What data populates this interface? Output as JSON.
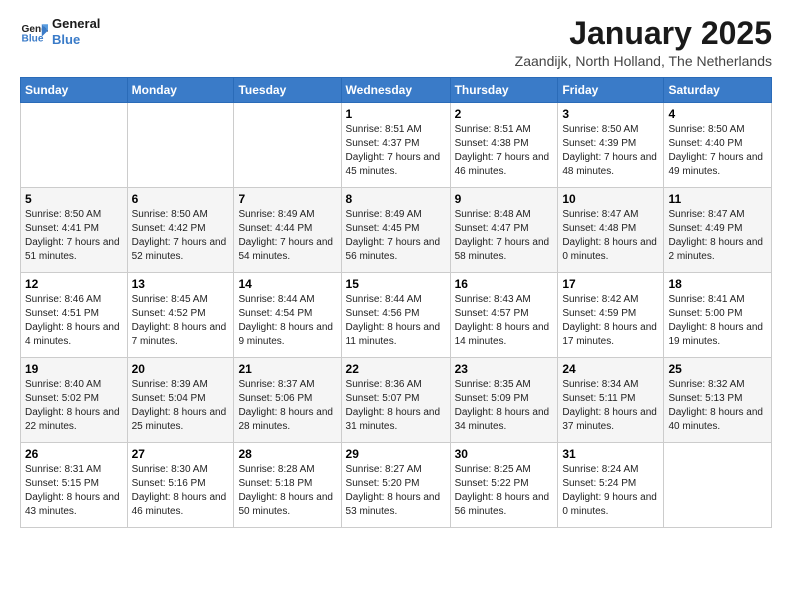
{
  "logo": {
    "text_general": "General",
    "text_blue": "Blue"
  },
  "header": {
    "title": "January 2025",
    "subtitle": "Zaandijk, North Holland, The Netherlands"
  },
  "weekdays": [
    "Sunday",
    "Monday",
    "Tuesday",
    "Wednesday",
    "Thursday",
    "Friday",
    "Saturday"
  ],
  "weeks": [
    [
      {
        "day": "",
        "sunrise": "",
        "sunset": "",
        "daylight": ""
      },
      {
        "day": "",
        "sunrise": "",
        "sunset": "",
        "daylight": ""
      },
      {
        "day": "",
        "sunrise": "",
        "sunset": "",
        "daylight": ""
      },
      {
        "day": "1",
        "sunrise": "Sunrise: 8:51 AM",
        "sunset": "Sunset: 4:37 PM",
        "daylight": "Daylight: 7 hours and 45 minutes."
      },
      {
        "day": "2",
        "sunrise": "Sunrise: 8:51 AM",
        "sunset": "Sunset: 4:38 PM",
        "daylight": "Daylight: 7 hours and 46 minutes."
      },
      {
        "day": "3",
        "sunrise": "Sunrise: 8:50 AM",
        "sunset": "Sunset: 4:39 PM",
        "daylight": "Daylight: 7 hours and 48 minutes."
      },
      {
        "day": "4",
        "sunrise": "Sunrise: 8:50 AM",
        "sunset": "Sunset: 4:40 PM",
        "daylight": "Daylight: 7 hours and 49 minutes."
      }
    ],
    [
      {
        "day": "5",
        "sunrise": "Sunrise: 8:50 AM",
        "sunset": "Sunset: 4:41 PM",
        "daylight": "Daylight: 7 hours and 51 minutes."
      },
      {
        "day": "6",
        "sunrise": "Sunrise: 8:50 AM",
        "sunset": "Sunset: 4:42 PM",
        "daylight": "Daylight: 7 hours and 52 minutes."
      },
      {
        "day": "7",
        "sunrise": "Sunrise: 8:49 AM",
        "sunset": "Sunset: 4:44 PM",
        "daylight": "Daylight: 7 hours and 54 minutes."
      },
      {
        "day": "8",
        "sunrise": "Sunrise: 8:49 AM",
        "sunset": "Sunset: 4:45 PM",
        "daylight": "Daylight: 7 hours and 56 minutes."
      },
      {
        "day": "9",
        "sunrise": "Sunrise: 8:48 AM",
        "sunset": "Sunset: 4:47 PM",
        "daylight": "Daylight: 7 hours and 58 minutes."
      },
      {
        "day": "10",
        "sunrise": "Sunrise: 8:47 AM",
        "sunset": "Sunset: 4:48 PM",
        "daylight": "Daylight: 8 hours and 0 minutes."
      },
      {
        "day": "11",
        "sunrise": "Sunrise: 8:47 AM",
        "sunset": "Sunset: 4:49 PM",
        "daylight": "Daylight: 8 hours and 2 minutes."
      }
    ],
    [
      {
        "day": "12",
        "sunrise": "Sunrise: 8:46 AM",
        "sunset": "Sunset: 4:51 PM",
        "daylight": "Daylight: 8 hours and 4 minutes."
      },
      {
        "day": "13",
        "sunrise": "Sunrise: 8:45 AM",
        "sunset": "Sunset: 4:52 PM",
        "daylight": "Daylight: 8 hours and 7 minutes."
      },
      {
        "day": "14",
        "sunrise": "Sunrise: 8:44 AM",
        "sunset": "Sunset: 4:54 PM",
        "daylight": "Daylight: 8 hours and 9 minutes."
      },
      {
        "day": "15",
        "sunrise": "Sunrise: 8:44 AM",
        "sunset": "Sunset: 4:56 PM",
        "daylight": "Daylight: 8 hours and 11 minutes."
      },
      {
        "day": "16",
        "sunrise": "Sunrise: 8:43 AM",
        "sunset": "Sunset: 4:57 PM",
        "daylight": "Daylight: 8 hours and 14 minutes."
      },
      {
        "day": "17",
        "sunrise": "Sunrise: 8:42 AM",
        "sunset": "Sunset: 4:59 PM",
        "daylight": "Daylight: 8 hours and 17 minutes."
      },
      {
        "day": "18",
        "sunrise": "Sunrise: 8:41 AM",
        "sunset": "Sunset: 5:00 PM",
        "daylight": "Daylight: 8 hours and 19 minutes."
      }
    ],
    [
      {
        "day": "19",
        "sunrise": "Sunrise: 8:40 AM",
        "sunset": "Sunset: 5:02 PM",
        "daylight": "Daylight: 8 hours and 22 minutes."
      },
      {
        "day": "20",
        "sunrise": "Sunrise: 8:39 AM",
        "sunset": "Sunset: 5:04 PM",
        "daylight": "Daylight: 8 hours and 25 minutes."
      },
      {
        "day": "21",
        "sunrise": "Sunrise: 8:37 AM",
        "sunset": "Sunset: 5:06 PM",
        "daylight": "Daylight: 8 hours and 28 minutes."
      },
      {
        "day": "22",
        "sunrise": "Sunrise: 8:36 AM",
        "sunset": "Sunset: 5:07 PM",
        "daylight": "Daylight: 8 hours and 31 minutes."
      },
      {
        "day": "23",
        "sunrise": "Sunrise: 8:35 AM",
        "sunset": "Sunset: 5:09 PM",
        "daylight": "Daylight: 8 hours and 34 minutes."
      },
      {
        "day": "24",
        "sunrise": "Sunrise: 8:34 AM",
        "sunset": "Sunset: 5:11 PM",
        "daylight": "Daylight: 8 hours and 37 minutes."
      },
      {
        "day": "25",
        "sunrise": "Sunrise: 8:32 AM",
        "sunset": "Sunset: 5:13 PM",
        "daylight": "Daylight: 8 hours and 40 minutes."
      }
    ],
    [
      {
        "day": "26",
        "sunrise": "Sunrise: 8:31 AM",
        "sunset": "Sunset: 5:15 PM",
        "daylight": "Daylight: 8 hours and 43 minutes."
      },
      {
        "day": "27",
        "sunrise": "Sunrise: 8:30 AM",
        "sunset": "Sunset: 5:16 PM",
        "daylight": "Daylight: 8 hours and 46 minutes."
      },
      {
        "day": "28",
        "sunrise": "Sunrise: 8:28 AM",
        "sunset": "Sunset: 5:18 PM",
        "daylight": "Daylight: 8 hours and 50 minutes."
      },
      {
        "day": "29",
        "sunrise": "Sunrise: 8:27 AM",
        "sunset": "Sunset: 5:20 PM",
        "daylight": "Daylight: 8 hours and 53 minutes."
      },
      {
        "day": "30",
        "sunrise": "Sunrise: 8:25 AM",
        "sunset": "Sunset: 5:22 PM",
        "daylight": "Daylight: 8 hours and 56 minutes."
      },
      {
        "day": "31",
        "sunrise": "Sunrise: 8:24 AM",
        "sunset": "Sunset: 5:24 PM",
        "daylight": "Daylight: 9 hours and 0 minutes."
      },
      {
        "day": "",
        "sunrise": "",
        "sunset": "",
        "daylight": ""
      }
    ]
  ]
}
